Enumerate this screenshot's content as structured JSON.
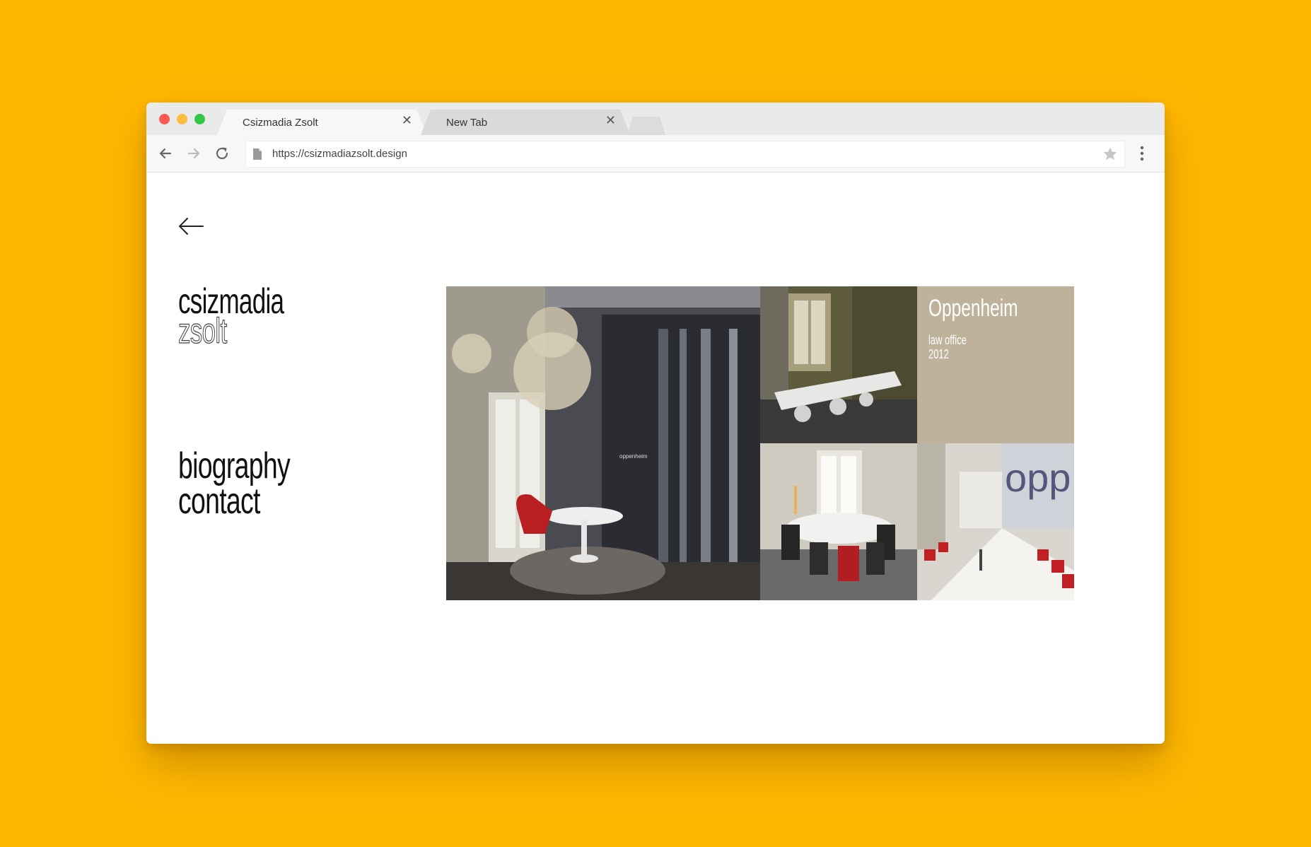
{
  "browser": {
    "tabs": [
      {
        "title": "Csizmadia Zsolt",
        "active": true
      },
      {
        "title": "New Tab",
        "active": false
      }
    ],
    "url": "https://csizmadiazsolt.design"
  },
  "site": {
    "logo_line1": "csizmadia",
    "logo_line2": "zsolt",
    "menu": [
      "biography",
      "contact"
    ],
    "project": {
      "title": "Oppenheim",
      "subtitle": "law office",
      "year": "2012",
      "sign_text": "oppenheim",
      "wall_text": "opp"
    }
  },
  "colors": {
    "background": "#FFB800",
    "info_tile": "#BEB29A"
  }
}
